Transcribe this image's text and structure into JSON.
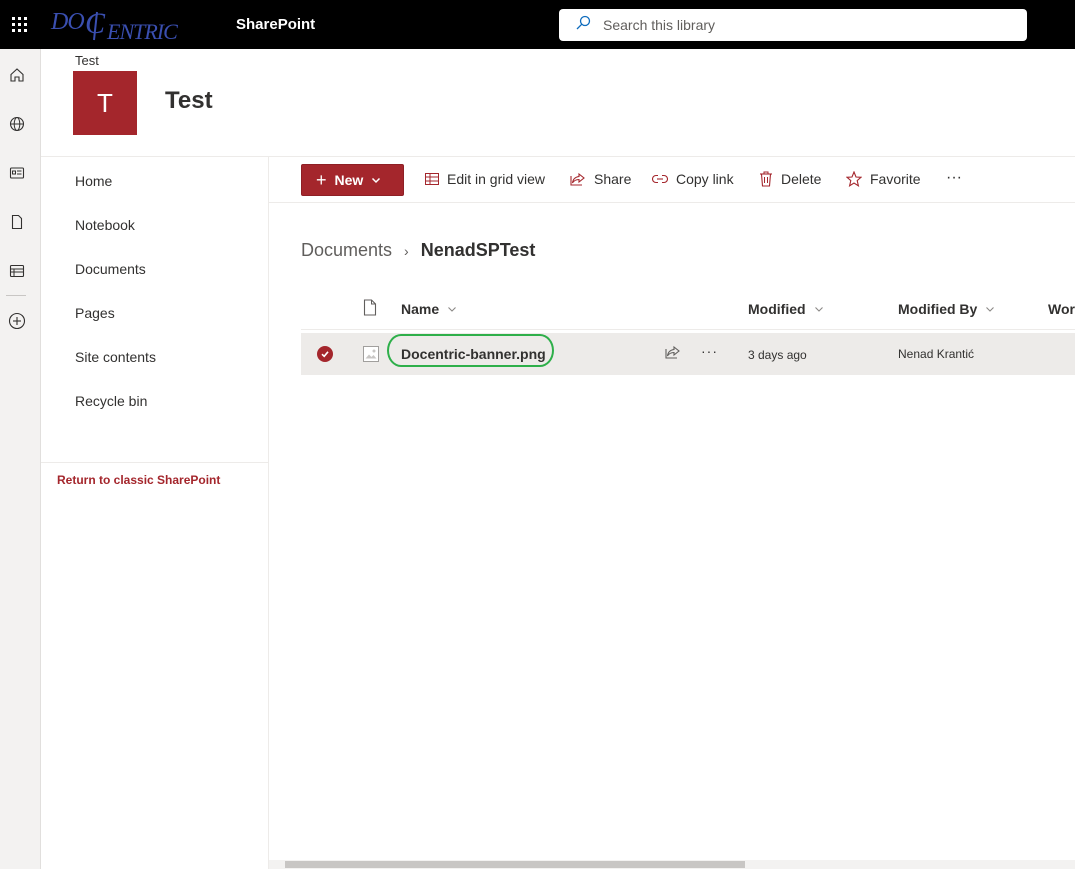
{
  "suite": {
    "logo_text": "DOCENTRIC",
    "title": "SharePoint",
    "search_placeholder": "Search this library"
  },
  "appbar": {
    "icons": [
      "home-icon",
      "globe-icon",
      "news-icon",
      "file-icon",
      "list-icon",
      "add-circle-icon"
    ]
  },
  "site": {
    "breadcrumb": "Test",
    "logo_letter": "T",
    "title": "Test",
    "brand_color": "#a4262c"
  },
  "leftnav": {
    "items": [
      "Home",
      "Notebook",
      "Documents",
      "Pages",
      "Site contents",
      "Recycle bin"
    ],
    "classic_link": "Return to classic SharePoint"
  },
  "commandbar": {
    "new_label": "New",
    "edit_grid_label": "Edit in grid view",
    "share_label": "Share",
    "copy_link_label": "Copy link",
    "delete_label": "Delete",
    "favorite_label": "Favorite",
    "more_label": "···"
  },
  "breadcrumb": {
    "root": "Documents",
    "separator": "›",
    "current": "NenadSPTest"
  },
  "list": {
    "columns": {
      "name": "Name",
      "modified": "Modified",
      "modified_by": "Modified By",
      "workflow": "Wor"
    },
    "rows": [
      {
        "name": "Docentric-banner.png",
        "modified": "3 days ago",
        "modified_by": "Nenad Krantić",
        "selected": true,
        "more": "···"
      }
    ]
  }
}
